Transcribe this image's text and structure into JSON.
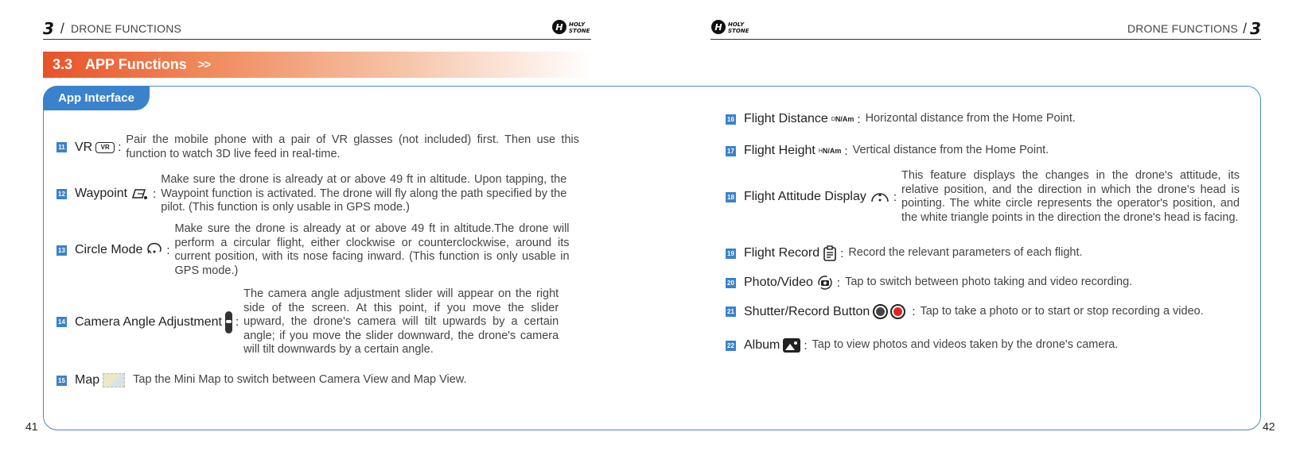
{
  "header_left": {
    "chapter_num": "3",
    "slash": "/",
    "title": "DRONE FUNCTIONS",
    "logo": "HOLY STONE"
  },
  "header_right": {
    "chapter_num": "3",
    "slash": "/",
    "title": "DRONE FUNCTIONS",
    "logo": "HOLY STONE"
  },
  "section": {
    "num": "3.3",
    "title": "APP Functions",
    "chevron": ">>"
  },
  "tab": "App Interface",
  "pages": {
    "left": "41",
    "right": "42"
  },
  "items": [
    {
      "num": "11",
      "label": "VR",
      "icon": "vr-glasses-icon",
      "icon_text": "VR",
      "desc": "Pair the mobile phone with a pair of VR glasses (not included) first. Then use this function to watch 3D live feed in real-time."
    },
    {
      "num": "12",
      "label": "Waypoint",
      "icon": "waypoint-icon",
      "desc": "Make sure the drone is already at or above 49 ft in altitude. Upon tapping, the Waypoint function is activated. The drone will fly along the path specified by the pilot. (This function is only usable in GPS mode.)"
    },
    {
      "num": "13",
      "label": "Circle Mode",
      "icon": "circle-mode-icon",
      "desc": "Make sure the drone is already at or above 49 ft in altitude.The drone will perform a circular flight, either clockwise or counterclockwise, around its current position, with its nose facing inward. (This function is only usable in GPS mode.)"
    },
    {
      "num": "14",
      "label": "Camera Angle Adjustment",
      "icon": "camera-angle-slider-icon",
      "desc": "The camera angle adjustment slider will appear on the right side of the screen. At this point, if you move the slider upward, the drone's camera will tilt upwards by a certain angle; if you move the slider downward, the drone's camera will tilt downwards by a certain angle."
    },
    {
      "num": "15",
      "label": "Map",
      "icon": "mini-map-icon",
      "desc": "Tap the Mini Map to switch between Camera View and Map View."
    },
    {
      "num": "16",
      "label": "Flight Distance",
      "icon": "flight-distance-icon",
      "icon_top": "D",
      "icon_text": "N/Am",
      "desc": "Horizontal distance from the Home Point."
    },
    {
      "num": "17",
      "label": "Flight Height",
      "icon": "flight-height-icon",
      "icon_top": "H",
      "icon_text": "N/Am",
      "desc": "Vertical distance from the Home Point."
    },
    {
      "num": "18",
      "label": "Flight Attitude Display",
      "icon": "attitude-display-icon",
      "desc": "This feature displays the changes in the drone's attitude, its relative position, and the direction in which the drone's head is pointing. The white circle represents the operator's position, and the white triangle points in the direction the drone's head is facing."
    },
    {
      "num": "19",
      "label": "Flight Record",
      "icon": "flight-record-icon",
      "desc": "Record the relevant parameters of each flight."
    },
    {
      "num": "20",
      "label": "Photo/Video",
      "icon": "photo-video-switch-icon",
      "desc": "Tap to switch between photo taking and video recording."
    },
    {
      "num": "21",
      "label": "Shutter/Record Button",
      "icon": "shutter-record-icon",
      "desc": "Tap to take a photo or to start or stop recording a video."
    },
    {
      "num": "22",
      "label": "Album",
      "icon": "album-icon",
      "desc": "Tap to view photos and videos taken by the drone's camera."
    }
  ],
  "colors": {
    "accent": "#3b82cc",
    "section": "#e8522a",
    "record_red": "#e62222"
  }
}
